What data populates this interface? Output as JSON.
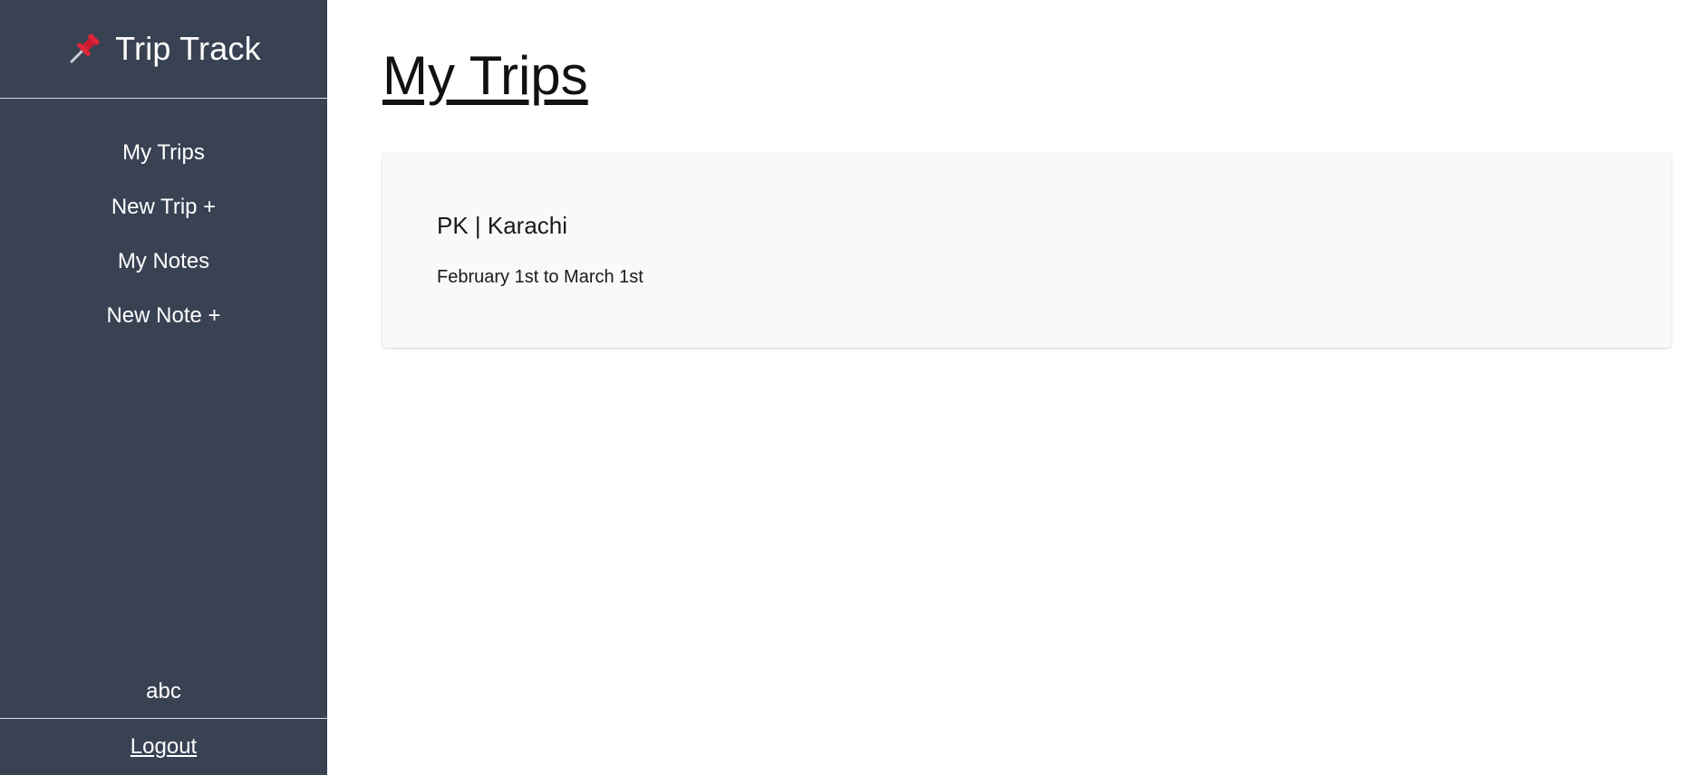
{
  "sidebar": {
    "brand": {
      "icon": "pushpin-icon",
      "title": "Trip Track"
    },
    "items": [
      {
        "label": "My Trips"
      },
      {
        "label": "New Trip +"
      },
      {
        "label": "My Notes"
      },
      {
        "label": "New Note +"
      }
    ],
    "user": "abc",
    "logout_label": "Logout"
  },
  "main": {
    "title": "My Trips",
    "trips": [
      {
        "location": "PK | Karachi",
        "dates": "February 1st to March 1st"
      }
    ]
  },
  "colors": {
    "sidebar_bg": "#394253",
    "card_bg": "#f8f9fa",
    "pin_red": "#e0243a"
  }
}
